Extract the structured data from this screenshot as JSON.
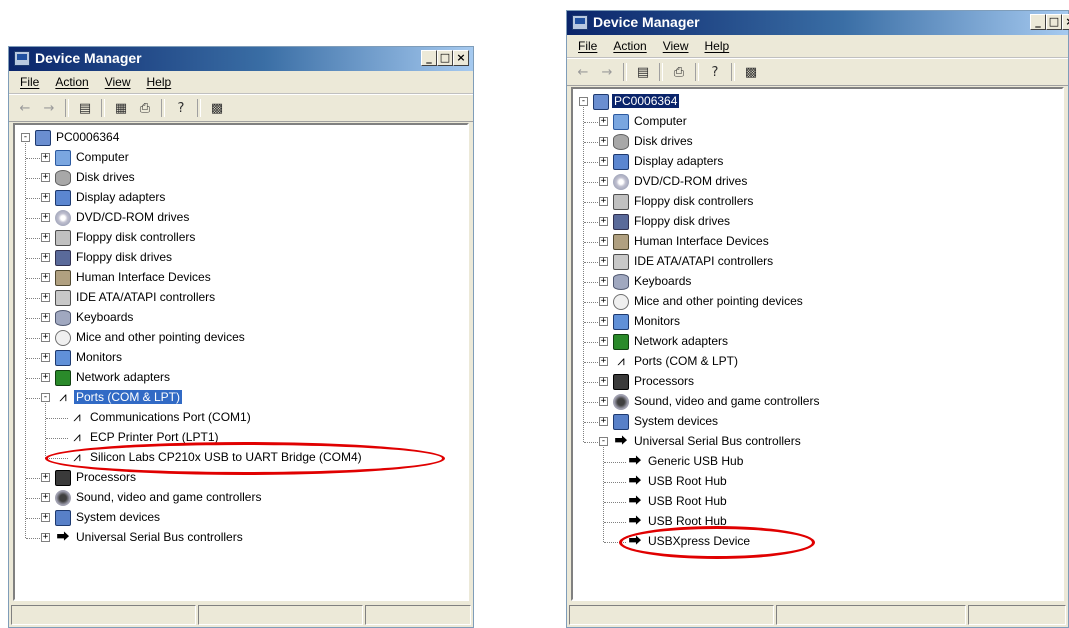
{
  "title": "Device Manager",
  "menu": [
    "File",
    "Action",
    "View",
    "Help"
  ],
  "caption_buttons": [
    "_",
    "□",
    "×"
  ],
  "colors": {
    "selection": "#316ac5",
    "highlight_ellipse": "#e00000",
    "titlebar": "#0a246a"
  },
  "left_window": {
    "root": "PC0006364",
    "categories_before": [
      "Computer",
      "Disk drives",
      "Display adapters",
      "DVD/CD-ROM drives",
      "Floppy disk controllers",
      "Floppy disk drives",
      "Human Interface Devices",
      "IDE ATA/ATAPI controllers",
      "Keyboards",
      "Mice and other pointing devices",
      "Monitors",
      "Network adapters"
    ],
    "expanded_category": "Ports (COM & LPT)",
    "children": [
      "Communications Port (COM1)",
      "ECP Printer Port (LPT1)",
      "Silicon Labs CP210x USB to UART Bridge (COM4)"
    ],
    "categories_after": [
      "Processors",
      "Sound, video and game controllers",
      "System devices",
      "Universal Serial Bus controllers"
    ]
  },
  "right_window": {
    "root": "PC0006364",
    "categories_before": [
      "Computer",
      "Disk drives",
      "Display adapters",
      "DVD/CD-ROM drives",
      "Floppy disk controllers",
      "Floppy disk drives",
      "Human Interface Devices",
      "IDE ATA/ATAPI controllers",
      "Keyboards",
      "Mice and other pointing devices",
      "Monitors",
      "Network adapters",
      "Ports (COM & LPT)",
      "Processors",
      "Sound, video and game controllers",
      "System devices"
    ],
    "expanded_category": "Universal Serial Bus controllers",
    "children": [
      "Generic USB Hub",
      "USB Root Hub",
      "USB Root Hub",
      "USB Root Hub",
      "USBXpress Device"
    ]
  }
}
